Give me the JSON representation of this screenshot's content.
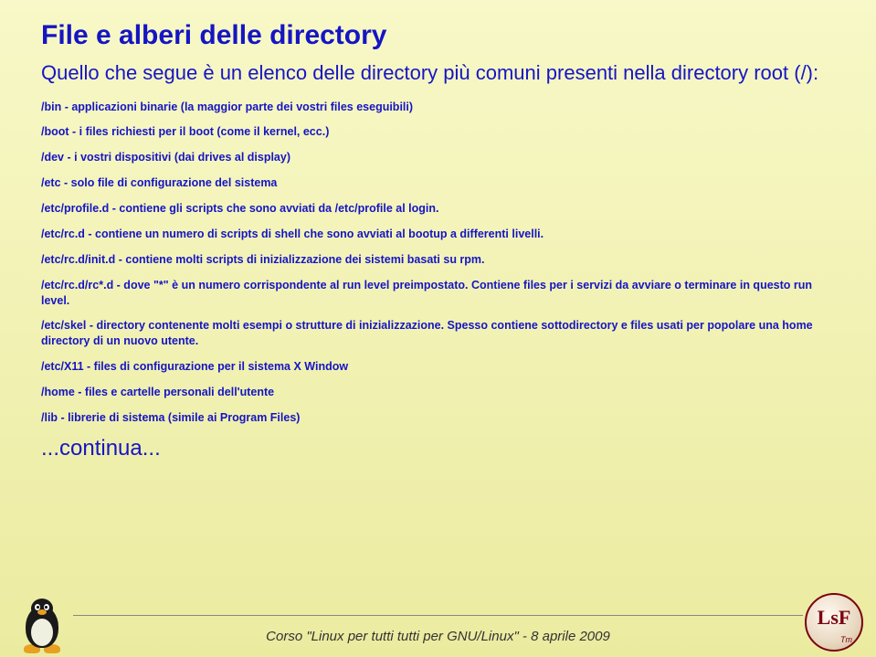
{
  "title": "File e alberi delle directory",
  "intro": "Quello che segue è un elenco delle directory più comuni presenti nella directory root (/):",
  "items": [
    "/bin - applicazioni binarie (la maggior parte dei vostri files eseguibili)",
    "/boot - i files richiesti per il boot (come il kernel, ecc.)",
    "/dev - i vostri dispositivi (dai drives al display)",
    "/etc - solo file di configurazione del sistema",
    "/etc/profile.d - contiene gli scripts che sono avviati da /etc/profile al login.",
    "/etc/rc.d - contiene un numero di scripts di shell che sono avviati al bootup a differenti livelli.",
    "/etc/rc.d/init.d - contiene molti scripts di inizializzazione dei sistemi basati su rpm.",
    "/etc/rc.d/rc*.d - dove \"*\" è un numero corrispondente al run level preimpostato. Contiene files per i servizi da avviare o terminare in questo run level.",
    "/etc/skel - directory contenente molti esempi o strutture di inizializzazione. Spesso contiene sottodirectory e files usati per popolare una home directory di un nuovo utente.",
    "/etc/X11 - files di configurazione per il sistema X Window",
    "/home - files e cartelle personali dell'utente",
    "/lib - librerie di sistema (simile ai Program Files)"
  ],
  "continua": "...continua...",
  "footer": {
    "prefix": "Corso ",
    "quoted": "\"Linux per tutti tutti per GNU/Linux\"",
    "suffix": " - 8 aprile 2009"
  },
  "logo": {
    "letters": "LsF",
    "tm": "Tm"
  }
}
